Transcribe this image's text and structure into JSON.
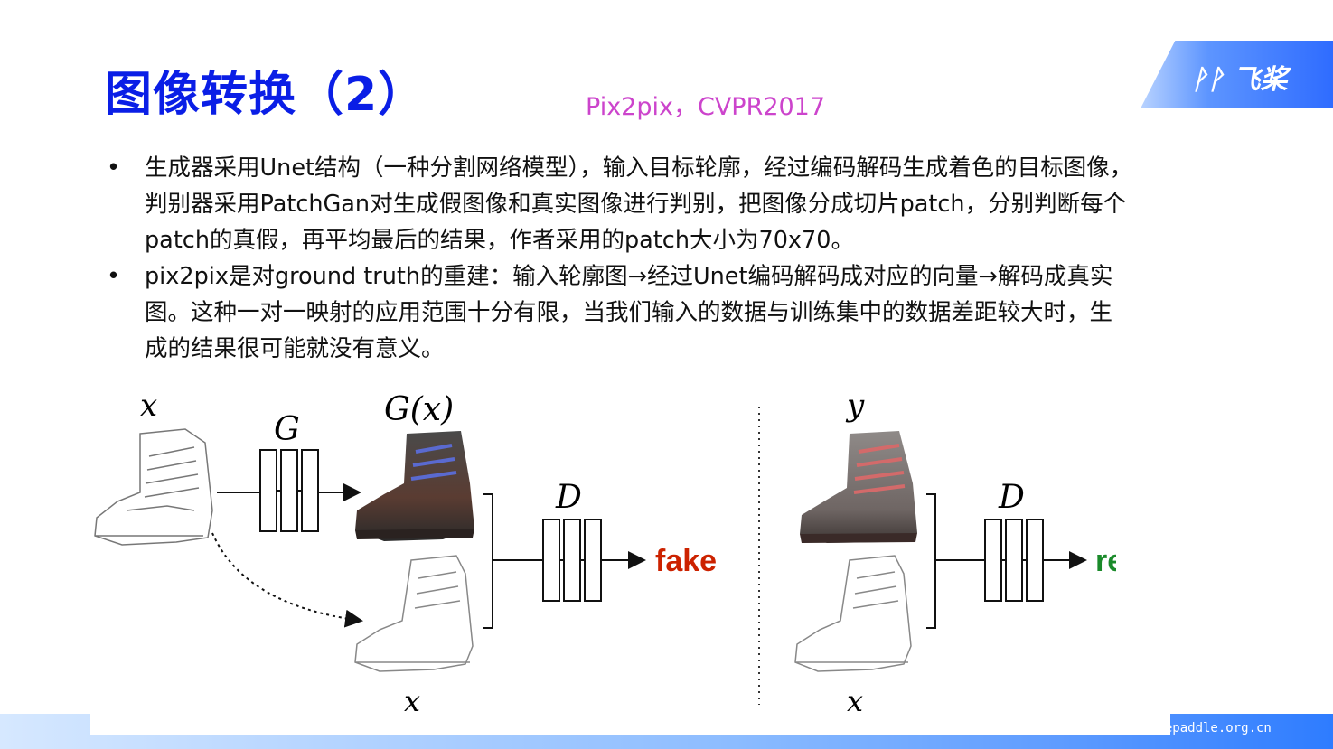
{
  "header": {
    "title": "图像转换（2）",
    "subtitle": "Pix2pix，CVPR2017",
    "logo_text": "飞桨"
  },
  "bullets": [
    {
      "marker": "•",
      "lines": [
        "生成器采用Unet结构（一种分割网络模型），输入目标轮廓，经过编码解码生成着色的目标图像，",
        "判别器采用PatchGan对生成假图像和真实图像进行判别，把图像分成切片patch，分别判断每个",
        "patch的真假，再平均最后的结果，作者采用的patch大小为70x70。"
      ]
    },
    {
      "marker": "•",
      "lines": [
        "pix2pix是对ground truth的重建：输入轮廓图→经过Unet编码解码成对应的向量→解码成真实",
        "图。这种一对一映射的应用范围十分有限，当我们输入的数据与训练集中的数据差距较大时，生",
        "成的结果很可能就没有意义。"
      ]
    }
  ],
  "diagram": {
    "left": {
      "input_label": "x",
      "generator_label": "G",
      "generated_label": "G(x)",
      "condition_label": "x",
      "discriminator_label": "D",
      "output_label": "fake",
      "output_color": "#cc2200"
    },
    "right": {
      "real_label": "y",
      "condition_label": "x",
      "discriminator_label": "D",
      "output_label": "real",
      "output_color": "#1a8a2a"
    }
  },
  "footer": {
    "url": "llepaddle.org.cn"
  }
}
